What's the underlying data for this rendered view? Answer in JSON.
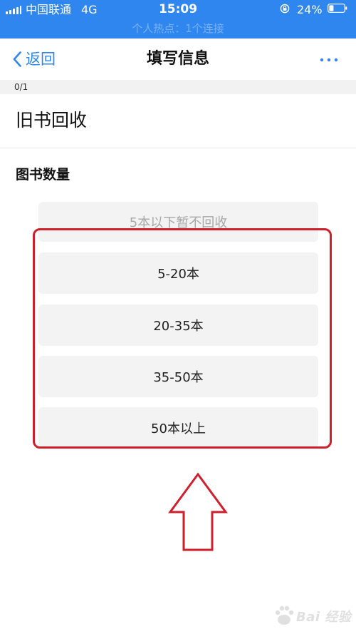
{
  "status_bar": {
    "carrier": "中国联通",
    "network": "4G",
    "time": "15:09",
    "battery": "24%",
    "hotspot_banner": "个人热点：1个连接"
  },
  "nav": {
    "back_label": "返回",
    "title": "填写信息"
  },
  "progress": {
    "text": "0/1"
  },
  "form": {
    "title": "旧书回收",
    "question": "图书数量",
    "options": [
      {
        "label": "5本以下暂不回收",
        "disabled": true
      },
      {
        "label": "5-20本",
        "disabled": false
      },
      {
        "label": "20-35本",
        "disabled": false
      },
      {
        "label": "35-50本",
        "disabled": false
      },
      {
        "label": "50本以上",
        "disabled": false
      }
    ]
  },
  "colors": {
    "accent": "#2f86ee",
    "annotation": "#d01f2c",
    "option_bg": "#f3f3f3"
  },
  "icons": {
    "back": "chevron-left-icon",
    "more": "more-dots-icon",
    "signal": "signal-bars-icon",
    "battery": "battery-icon",
    "orientation_lock": "orientation-lock-icon"
  },
  "watermark": {
    "text": "Bai 经验"
  }
}
